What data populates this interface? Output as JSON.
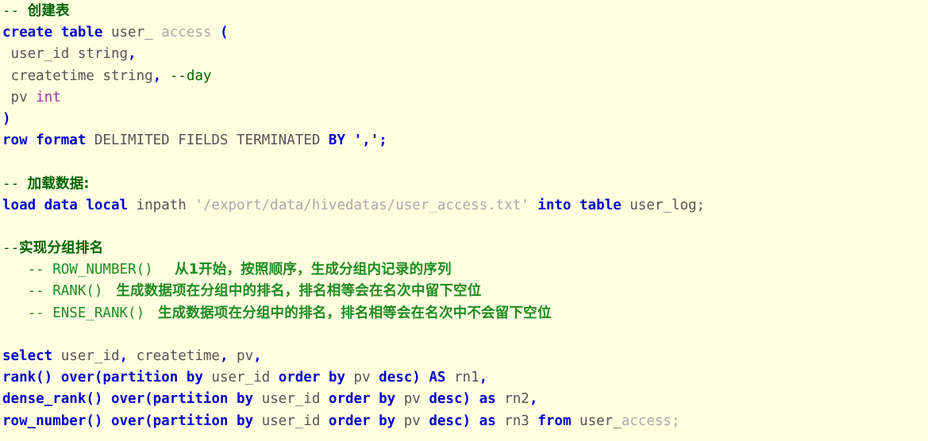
{
  "document": {
    "kind": "sql-code-snippet",
    "language": "HiveQL",
    "background_color": "#ffffe0",
    "colors": {
      "keyword": "#0000cd",
      "identifier": "#555555",
      "string": "#aaaaaa",
      "comment": "#006400",
      "comment_secondary": "#1f8b1f",
      "type": "#993399",
      "punctuation": "#0000cd"
    },
    "lines": [
      {
        "id": "line-1",
        "tokens": [
          {
            "t": "--",
            "c": "cmt"
          },
          {
            "t": " ",
            "c": "cmt"
          },
          {
            "t": "创建表",
            "c": "cmt cn"
          }
        ]
      },
      {
        "id": "line-2",
        "tokens": [
          {
            "t": "create table",
            "c": "kw"
          },
          {
            "t": " ",
            "c": "id"
          },
          {
            "t": "user_",
            "c": "id"
          },
          {
            "t": " ",
            "c": "id"
          },
          {
            "t": "access",
            "c": "str"
          },
          {
            "t": " ",
            "c": "id"
          },
          {
            "t": "(",
            "c": "pun"
          }
        ]
      },
      {
        "id": "line-3",
        "tokens": [
          {
            "t": " user_id string",
            "c": "id"
          },
          {
            "t": ",",
            "c": "pun"
          }
        ]
      },
      {
        "id": "line-4",
        "tokens": [
          {
            "t": " createtime string",
            "c": "id"
          },
          {
            "t": ",",
            "c": "pun"
          },
          {
            "t": " ",
            "c": "id"
          },
          {
            "t": "--day",
            "c": "cmt"
          }
        ]
      },
      {
        "id": "line-5",
        "tokens": [
          {
            "t": " pv ",
            "c": "id"
          },
          {
            "t": "int",
            "c": "typ"
          }
        ]
      },
      {
        "id": "line-6",
        "tokens": [
          {
            "t": ")",
            "c": "pun"
          }
        ]
      },
      {
        "id": "line-7",
        "tokens": [
          {
            "t": "row format",
            "c": "kw"
          },
          {
            "t": " DELIMITED FIELDS TERMINATED ",
            "c": "id"
          },
          {
            "t": "BY",
            "c": "kw"
          },
          {
            "t": " ",
            "c": "id"
          },
          {
            "t": "',';",
            "c": "pun"
          }
        ]
      },
      {
        "id": "line-8",
        "tokens": []
      },
      {
        "id": "line-9",
        "tokens": [
          {
            "t": "--",
            "c": "cmt"
          },
          {
            "t": " ",
            "c": "cmt"
          },
          {
            "t": "加载数据:",
            "c": "cmt cn"
          }
        ]
      },
      {
        "id": "line-10",
        "tokens": [
          {
            "t": "load data local",
            "c": "kw"
          },
          {
            "t": " inpath ",
            "c": "id"
          },
          {
            "t": "'/export/data/hivedatas/user_access.txt'",
            "c": "str"
          },
          {
            "t": " ",
            "c": "id"
          },
          {
            "t": "into table",
            "c": "kw"
          },
          {
            "t": " user_log;",
            "c": "id"
          }
        ]
      },
      {
        "id": "line-11",
        "tokens": []
      },
      {
        "id": "line-12",
        "tokens": [
          {
            "t": "--",
            "c": "cmt"
          },
          {
            "t": "实现分组排名",
            "c": "cmt cn"
          }
        ]
      },
      {
        "id": "line-13",
        "tokens": [
          {
            "t": "   -- ROW_NUMBER()  ",
            "c": "cmt2"
          },
          {
            "t": " 从1开始，按照顺序，生成分组内记录的序列",
            "c": "cmt2 cn"
          }
        ]
      },
      {
        "id": "line-14",
        "tokens": [
          {
            "t": "   -- RANK() ",
            "c": "cmt2"
          },
          {
            "t": " 生成数据项在分组中的排名，排名相等会在名次中留下空位",
            "c": "cmt2 cn"
          }
        ]
      },
      {
        "id": "line-15",
        "tokens": [
          {
            "t": "   -- ENSE_RANK() ",
            "c": "cmt2"
          },
          {
            "t": " 生成数据项在分组中的排名，排名相等会在名次中不会留下空位",
            "c": "cmt2 cn"
          }
        ]
      },
      {
        "id": "line-16",
        "tokens": []
      },
      {
        "id": "line-17",
        "tokens": [
          {
            "t": "select",
            "c": "kw"
          },
          {
            "t": " user_id",
            "c": "id"
          },
          {
            "t": ",",
            "c": "pun"
          },
          {
            "t": " createtime",
            "c": "id"
          },
          {
            "t": ",",
            "c": "pun"
          },
          {
            "t": " pv",
            "c": "id"
          },
          {
            "t": ",",
            "c": "pun"
          }
        ]
      },
      {
        "id": "line-18",
        "tokens": [
          {
            "t": "rank() over(partition by",
            "c": "kw"
          },
          {
            "t": " user_id ",
            "c": "id"
          },
          {
            "t": "order by",
            "c": "kw"
          },
          {
            "t": " pv ",
            "c": "id"
          },
          {
            "t": "desc)",
            "c": "kw"
          },
          {
            "t": " ",
            "c": "id"
          },
          {
            "t": "AS",
            "c": "kw"
          },
          {
            "t": " rn1",
            "c": "id"
          },
          {
            "t": ",",
            "c": "pun"
          }
        ]
      },
      {
        "id": "line-19",
        "tokens": [
          {
            "t": "dense_rank() over(partition by",
            "c": "kw"
          },
          {
            "t": " user_id ",
            "c": "id"
          },
          {
            "t": "order by",
            "c": "kw"
          },
          {
            "t": " pv ",
            "c": "id"
          },
          {
            "t": "desc)",
            "c": "kw"
          },
          {
            "t": " ",
            "c": "id"
          },
          {
            "t": "as",
            "c": "kw"
          },
          {
            "t": " rn2",
            "c": "id"
          },
          {
            "t": ",",
            "c": "pun"
          }
        ]
      },
      {
        "id": "line-20",
        "tokens": [
          {
            "t": "row_number() over(partition by",
            "c": "kw"
          },
          {
            "t": " user_id ",
            "c": "id"
          },
          {
            "t": "order by",
            "c": "kw"
          },
          {
            "t": " pv ",
            "c": "id"
          },
          {
            "t": "desc)",
            "c": "kw"
          },
          {
            "t": " ",
            "c": "id"
          },
          {
            "t": "as",
            "c": "kw"
          },
          {
            "t": " rn3 ",
            "c": "id"
          },
          {
            "t": "from",
            "c": "kw"
          },
          {
            "t": " user_",
            "c": "id"
          },
          {
            "t": "access;",
            "c": "str"
          }
        ]
      }
    ]
  }
}
